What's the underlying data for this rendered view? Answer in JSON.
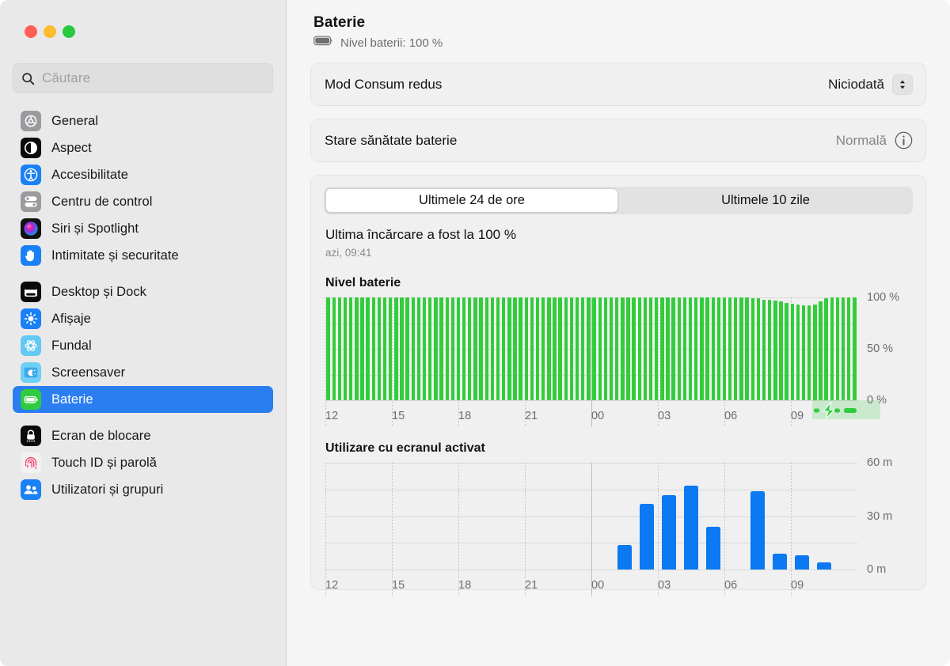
{
  "window": {
    "traffic_lights": [
      "close",
      "minimize",
      "zoom"
    ],
    "colors": {
      "close": "#ff5f57",
      "minimize": "#febc2e",
      "zoom": "#28c840",
      "accent": "#2b7ef0",
      "battery_green": "#32cd3a",
      "usage_blue": "#0a79f2"
    }
  },
  "search": {
    "placeholder": "Căutare",
    "value": "",
    "icon": "search-icon"
  },
  "sidebar": {
    "groups": [
      {
        "items": [
          {
            "label": "General",
            "icon": "gear-icon"
          },
          {
            "label": "Aspect",
            "icon": "appearance-icon"
          },
          {
            "label": "Accesibilitate",
            "icon": "accessibility-icon"
          },
          {
            "label": "Centru de control",
            "icon": "control-center-icon"
          },
          {
            "label": "Siri și Spotlight",
            "icon": "siri-icon"
          },
          {
            "label": "Intimitate și securitate",
            "icon": "privacy-hand-icon"
          }
        ]
      },
      {
        "items": [
          {
            "label": "Desktop și Dock",
            "icon": "desktop-dock-icon"
          },
          {
            "label": "Afișaje",
            "icon": "displays-brightness-icon"
          },
          {
            "label": "Fundal",
            "icon": "wallpaper-icon"
          },
          {
            "label": "Screensaver",
            "icon": "screensaver-icon"
          },
          {
            "label": "Baterie",
            "icon": "battery-icon",
            "selected": true
          }
        ]
      },
      {
        "items": [
          {
            "label": "Ecran de blocare",
            "icon": "lock-screen-icon"
          },
          {
            "label": "Touch ID și parolă",
            "icon": "touch-id-icon"
          },
          {
            "label": "Utilizatori și grupuri",
            "icon": "users-groups-icon"
          }
        ]
      }
    ]
  },
  "header": {
    "title": "Baterie",
    "battery_icon": "battery-full-icon",
    "subtitle": "Nivel baterii: 100 %"
  },
  "settings_rows": [
    {
      "label": "Mod Consum redus",
      "value": "Niciodată",
      "control": "popup-stepper",
      "icon": "chevron-updown-icon"
    },
    {
      "label": "Stare sănătate baterie",
      "value": "Normală",
      "control": "info-button",
      "icon": "info-circle-icon"
    }
  ],
  "tabs": [
    {
      "label": "Ultimele 24 de ore",
      "active": true
    },
    {
      "label": "Ultimele 10 zile",
      "active": false
    }
  ],
  "last_charge": {
    "headline": "Ultima încărcare a fost la 100 %",
    "time": "azi, 09:41"
  },
  "chart_data": [
    {
      "type": "bar",
      "name": "battery-level-chart",
      "title": "Nivel baterie",
      "xlabel": "",
      "ylabel": "",
      "ylim": [
        0,
        100
      ],
      "yticks": [
        0,
        50,
        100
      ],
      "ytick_labels": [
        "0 %",
        "50 %",
        "100 %"
      ],
      "xticks": [
        "12",
        "15",
        "18",
        "21",
        "00",
        "03",
        "06",
        "09"
      ],
      "grid": true,
      "bar_color": "#32cd3a",
      "values": [
        100,
        100,
        100,
        100,
        100,
        100,
        100,
        100,
        100,
        100,
        100,
        100,
        100,
        100,
        100,
        100,
        100,
        100,
        100,
        100,
        100,
        100,
        100,
        100,
        100,
        100,
        100,
        100,
        100,
        100,
        100,
        100,
        100,
        100,
        100,
        100,
        100,
        100,
        100,
        100,
        100,
        100,
        100,
        100,
        100,
        100,
        100,
        100,
        100,
        100,
        100,
        100,
        100,
        100,
        100,
        100,
        100,
        100,
        100,
        100,
        100,
        100,
        100,
        100,
        100,
        100,
        100,
        100,
        100,
        100,
        100,
        100,
        100,
        100,
        100,
        99,
        99,
        98,
        98,
        97,
        96,
        95,
        94,
        93,
        92,
        92,
        93,
        96,
        99,
        100,
        100,
        100,
        100,
        100
      ],
      "charging_periods": [
        {
          "start_index": 86,
          "end_index": 97,
          "label": "charging"
        }
      ],
      "annotations": [
        "charging-bolt-icon",
        "battery-plugged-icon"
      ]
    },
    {
      "type": "bar",
      "name": "screen-on-usage-chart",
      "title": "Utilizare cu ecranul activat",
      "xlabel": "",
      "ylabel": "",
      "ylim": [
        0,
        60
      ],
      "yticks": [
        0,
        30,
        60
      ],
      "ytick_labels": [
        "0 m",
        "30 m",
        "60 m"
      ],
      "xticks": [
        "12",
        "15",
        "18",
        "21",
        "00",
        "03",
        "06",
        "09"
      ],
      "grid": true,
      "bar_color": "#0a79f2",
      "categories": [
        "12",
        "13",
        "14",
        "15",
        "16",
        "17",
        "18",
        "19",
        "20",
        "21",
        "22",
        "23",
        "00",
        "01",
        "02",
        "03",
        "04",
        "05",
        "06",
        "07",
        "08",
        "09",
        "10",
        "11"
      ],
      "values": [
        0,
        0,
        0,
        0,
        0,
        0,
        0,
        0,
        0,
        0,
        0,
        0,
        0,
        14,
        37,
        42,
        47,
        24,
        0,
        44,
        9,
        8,
        4,
        0
      ]
    }
  ]
}
